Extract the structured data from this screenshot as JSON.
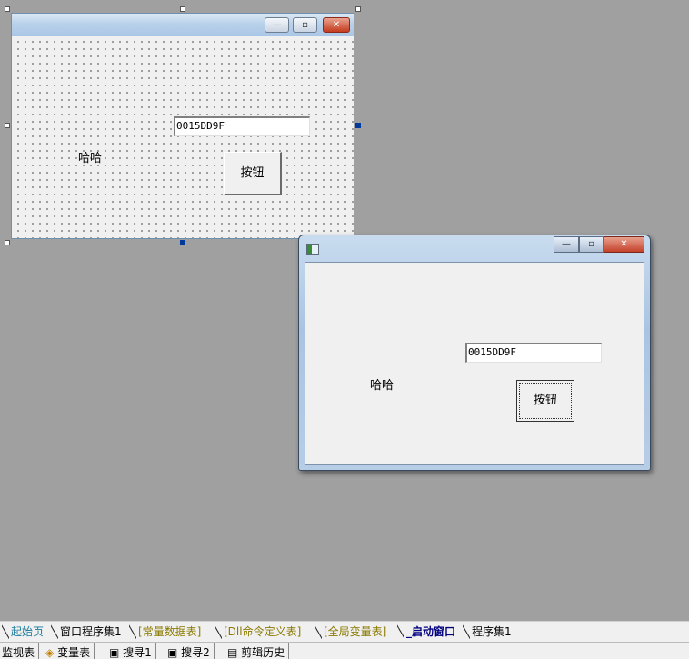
{
  "design_form": {
    "edit_text": "0015DD9F",
    "label_text": "哈哈",
    "button_text": "按钮",
    "minimize_glyph": "—",
    "maximize_glyph": "▫",
    "close_glyph": "✕"
  },
  "run_window": {
    "edit_text": "0015DD9F",
    "label_text": "哈哈",
    "button_text": "按钮",
    "minimize_glyph": "—",
    "maximize_glyph": "▫",
    "close_glyph": "✕",
    "app_icon": "window-app-icon"
  },
  "tabs": [
    {
      "label": "起始页",
      "color": "#1a7a9a"
    },
    {
      "label": "窗口程序集1",
      "color": "#000000"
    },
    {
      "label": "[常量数据表]",
      "color": "#8a7a00"
    },
    {
      "label": "[Dll命令定义表]",
      "color": "#8a7a00"
    },
    {
      "label": "[全局变量表]",
      "color": "#8a7a00"
    },
    {
      "label": "_启动窗口",
      "color": "#000080"
    },
    {
      "label": "程序集1",
      "color": "#000000"
    }
  ],
  "status_items": [
    {
      "label": "监视表",
      "icon": ""
    },
    {
      "label": "变量表",
      "icon": "variables-icon"
    },
    {
      "label": "搜寻1",
      "icon": "search-icon"
    },
    {
      "label": "搜寻2",
      "icon": "search-icon"
    },
    {
      "label": "剪辑历史",
      "icon": "clipboard-icon"
    }
  ]
}
